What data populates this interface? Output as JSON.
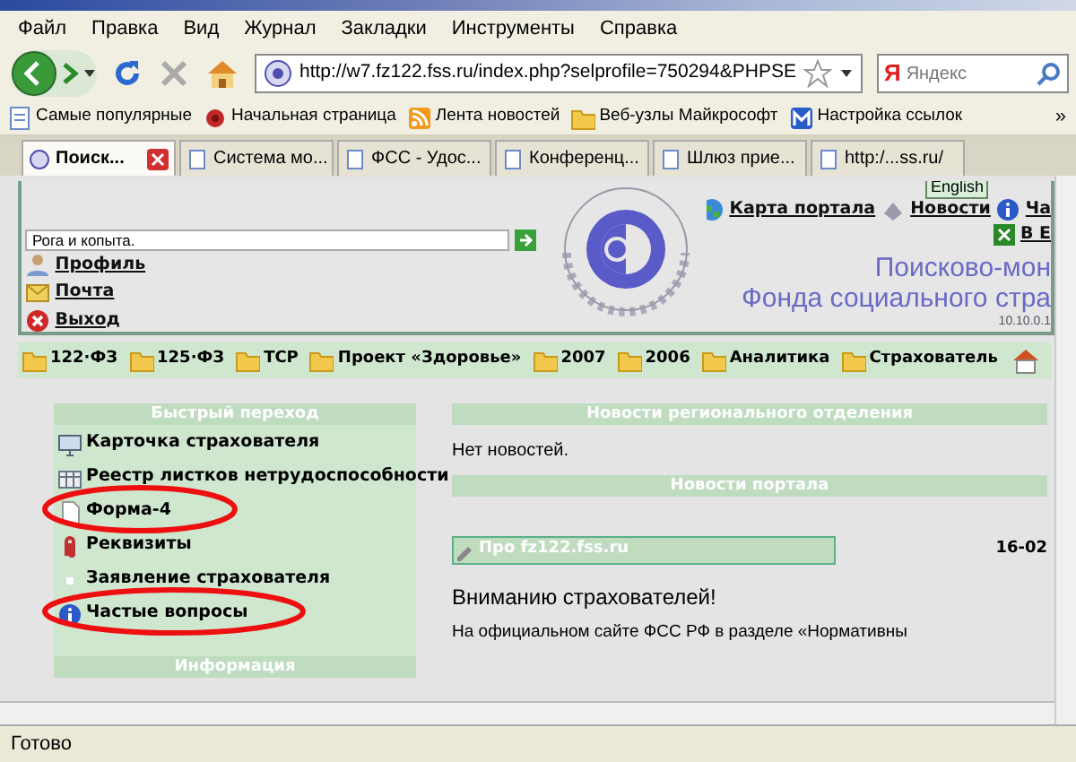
{
  "browser": {
    "menu": [
      "Файл",
      "Правка",
      "Вид",
      "Журнал",
      "Закладки",
      "Инструменты",
      "Справка"
    ],
    "url": "http://w7.fz122.fss.ru/index.php?selprofile=750294&PHPSE",
    "search": {
      "engine_glyph": "Я",
      "placeholder": "Яндекс"
    },
    "bookmarks": [
      {
        "label": "Самые популярные",
        "kind": "page"
      },
      {
        "label": "Начальная страница",
        "kind": "flower"
      },
      {
        "label": "Лента новостей",
        "kind": "feed"
      },
      {
        "label": "Веб-узлы Майкрософт",
        "kind": "folder"
      },
      {
        "label": "Настройка ссылок",
        "kind": "m"
      }
    ],
    "bookmarks_more": "»",
    "tabs": [
      {
        "label": "Поиск...",
        "selected": true
      },
      {
        "label": "Система мо...",
        "selected": false
      },
      {
        "label": "ФСС - Удос...",
        "selected": false
      },
      {
        "label": "Конференц...",
        "selected": false
      },
      {
        "label": "Шлюз прие...",
        "selected": false
      },
      {
        "label": "http:/...ss.ru/",
        "selected": false
      }
    ]
  },
  "page": {
    "header": {
      "org_select": "Рога и копыта.",
      "user_links": [
        {
          "label": "Профиль",
          "kind": "profile"
        },
        {
          "label": "Почта",
          "kind": "mail"
        },
        {
          "label": "Выход",
          "kind": "exit"
        }
      ],
      "top_links": [
        {
          "label": "Карта портала",
          "kind": "globe"
        },
        {
          "label": "Новости",
          "kind": "news"
        },
        {
          "label": "Ча",
          "kind": "info"
        }
      ],
      "tooltip": "English",
      "excel_link": "В E",
      "title_lines": [
        "Поисково-мон",
        "Фонда социального стра"
      ],
      "ip": "10.10.0.1"
    },
    "nav": [
      "122·ФЗ",
      "125·ФЗ",
      "ТСР",
      "Проект «Здоровье»",
      "2007",
      "2006",
      "Аналитика",
      "Страхователь"
    ],
    "quick": {
      "title": "Быстрый переход",
      "items": [
        {
          "label": "Карточка страхователя",
          "kind": "card",
          "circled": false
        },
        {
          "label": "Реестр листков нетрудоспособности",
          "kind": "table",
          "circled": false
        },
        {
          "label": "Форма-4",
          "kind": "doc",
          "circled": true
        },
        {
          "label": "Реквизиты",
          "kind": "clip",
          "circled": false
        },
        {
          "label": "Заявление страхователя",
          "kind": "dot",
          "circled": false
        },
        {
          "label": "Частые вопросы",
          "kind": "info",
          "circled": true
        }
      ]
    },
    "info_title": "Информация",
    "regional": {
      "title": "Новости регионального отделения",
      "text": "Нет новостей."
    },
    "portal": {
      "title": "Новости портала",
      "items": [
        {
          "title": "Про fz122.fss.ru",
          "date": "16-02"
        }
      ],
      "headline": "Вниманию страхователей!",
      "body": "На официальном сайте ФСС РФ в разделе «Нормативны"
    }
  },
  "status": "Готово"
}
